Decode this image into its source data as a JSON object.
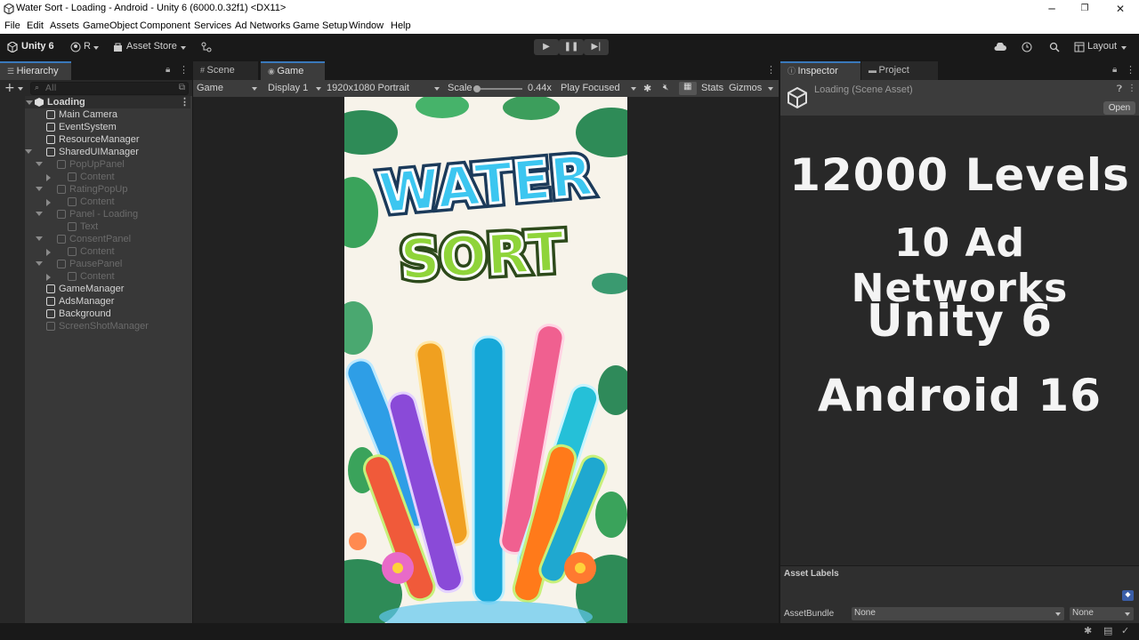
{
  "window": {
    "title": "Water Sort - Loading - Android - Unity 6 (6000.0.32f1) <DX11>",
    "minimize": "─",
    "maximize": "❐",
    "close": "✕"
  },
  "menu": [
    "File",
    "Edit",
    "Assets",
    "GameObject",
    "Component",
    "Services",
    "Ad Networks",
    "Game Setup",
    "Window",
    "Help"
  ],
  "toolbar": {
    "unity_label": "Unity 6",
    "account_label": "R",
    "asset_store": "Asset Store",
    "layout": "Layout"
  },
  "hierarchy": {
    "tab": "Hierarchy",
    "search_placeholder": "All",
    "scene": "Loading",
    "items": [
      {
        "label": "Main Camera",
        "depth": 1,
        "dim": false,
        "fold": "none"
      },
      {
        "label": "EventSystem",
        "depth": 1,
        "dim": false,
        "fold": "none"
      },
      {
        "label": "ResourceManager",
        "depth": 1,
        "dim": false,
        "fold": "none"
      },
      {
        "label": "SharedUIManager",
        "depth": 1,
        "dim": false,
        "fold": "open"
      },
      {
        "label": "PopUpPanel",
        "depth": 2,
        "dim": true,
        "fold": "open"
      },
      {
        "label": "Content",
        "depth": 3,
        "dim": true,
        "fold": "closed"
      },
      {
        "label": "RatingPopUp",
        "depth": 2,
        "dim": true,
        "fold": "open"
      },
      {
        "label": "Content",
        "depth": 3,
        "dim": true,
        "fold": "closed"
      },
      {
        "label": "Panel - Loading",
        "depth": 2,
        "dim": true,
        "fold": "open"
      },
      {
        "label": "Text",
        "depth": 3,
        "dim": true,
        "fold": "none"
      },
      {
        "label": "ConsentPanel",
        "depth": 2,
        "dim": true,
        "fold": "open"
      },
      {
        "label": "Content",
        "depth": 3,
        "dim": true,
        "fold": "closed"
      },
      {
        "label": "PausePanel",
        "depth": 2,
        "dim": true,
        "fold": "open"
      },
      {
        "label": "Content",
        "depth": 3,
        "dim": true,
        "fold": "closed"
      },
      {
        "label": "GameManager",
        "depth": 1,
        "dim": false,
        "fold": "none"
      },
      {
        "label": "AdsManager",
        "depth": 1,
        "dim": false,
        "fold": "none"
      },
      {
        "label": "Background",
        "depth": 1,
        "dim": false,
        "fold": "none"
      },
      {
        "label": "ScreenShotManager",
        "depth": 1,
        "dim": true,
        "fold": "none"
      }
    ]
  },
  "game_view": {
    "tab_scene": "Scene",
    "tab_game": "Game",
    "mode": "Game",
    "display": "Display 1",
    "resolution": "1920x1080 Portrait",
    "scale_label": "Scale",
    "scale_value": "0.44x",
    "scale_fraction": 0.0,
    "play_focus": "Play Focused",
    "stats": "Stats",
    "gizmos": "Gizmos",
    "logo_line1": "WATER",
    "logo_line2": "SORT"
  },
  "inspector": {
    "tab_inspector": "Inspector",
    "tab_project": "Project",
    "asset_title": "Loading (Scene Asset)",
    "open_button": "Open",
    "asset_labels": "Asset Labels",
    "asset_bundle_label": "AssetBundle",
    "asset_bundle_value": "None",
    "asset_variant_value": "None"
  },
  "overlay": {
    "line1": "12000 Levels",
    "line2": "10 Ad Networks",
    "line3": "Unity 6",
    "line4": "Android 16"
  },
  "colors": {
    "accent": "#3a79bb",
    "panel_bg": "#282828",
    "editor_bg": "#191919"
  }
}
